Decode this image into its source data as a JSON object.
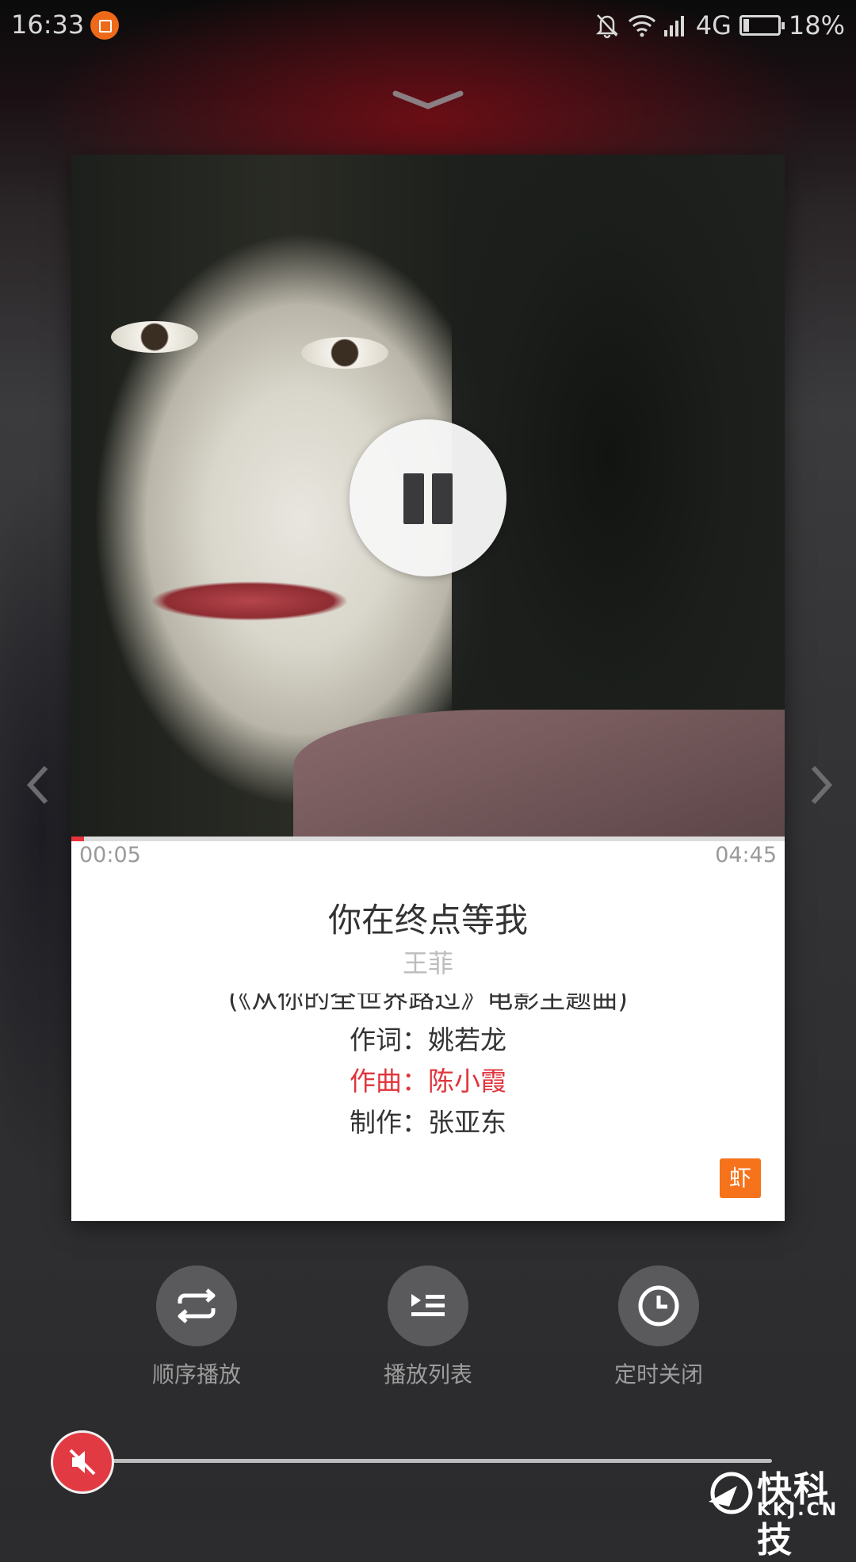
{
  "status_bar": {
    "time": "16:33",
    "network": "4G",
    "battery": "18%",
    "battery_level": 0.18,
    "icons": [
      "app-notification-icon",
      "bell-muted-icon",
      "wifi-icon",
      "signal-icon",
      "battery-icon"
    ]
  },
  "player": {
    "cover_icon": "album-cover",
    "play_state_icon": "pause-icon",
    "elapsed": "00:05",
    "duration": "04:45",
    "progress": 0.0175,
    "song_title": "你在终点等我",
    "artist": "王菲",
    "lyrics": [
      "(《从你的全世界路过》电影主题曲)",
      "作词：姚若龙",
      "作曲：陈小霞",
      "制作：张亚东"
    ],
    "active_lyric_index": 2,
    "source_badge": "虾",
    "accent_color": "#e0353d"
  },
  "controls": [
    {
      "label": "顺序播放",
      "icon": "repeat-icon"
    },
    {
      "label": "播放列表",
      "icon": "playlist-icon"
    },
    {
      "label": "定时关闭",
      "icon": "clock-icon"
    }
  ],
  "volume": {
    "level": 0.0,
    "icon": "mute-icon"
  },
  "watermark": {
    "text": "快科技",
    "sub": "KKJ.CN"
  }
}
